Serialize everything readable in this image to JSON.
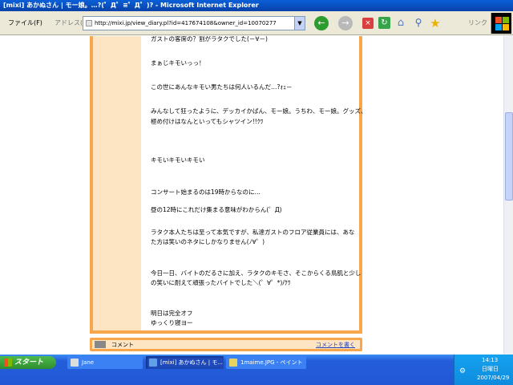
{
  "window": {
    "title": "[mixi] あかぬさん | モー娘。…?(゜Д゜≡゜Д゜)? - Microsoft Internet Explorer"
  },
  "toolbar": {
    "file_menu": "ファイル(F)",
    "address_label": "アドレス(D)",
    "address_url": "http://mixi.jp/view_diary.pl?id=417674108&owner_id=10070277",
    "links_label": "リンク"
  },
  "diary": {
    "lines": [
      "ガストの客席の？割がラタクでした(－∀－)",
      "まぁじキモいっっ！",
      "この世にあんなキモい男たちは何人いるんだ…?ｫｪ－",
      "みんなして狂ったように、デッカイかばん、モー娘。うちわ、モー娘。グッズ、",
      "極め付けはなんといってもシャツイン!!ｸﾜ",
      "キモいキモいキモい",
      "コンサート始まるのは19時からなのに…",
      "昼の12時にこれだけ集まる意味がわからん(゜Д)",
      "ラタク本人たちは至って本気ですが、私達ガストのフロア従業員には、あな",
      "た方は笑いのネタにしかなりません(ﾉ∀゜)",
      "今日一日、バイトのだるさに加え、ラタクのキモさ、そこからくる鳥肌と少し",
      "の笑いに耐えて頑張ったバイトでした＼(゜∀゜*)/ｸﾜ",
      "明日は完全オフ",
      "ゆっくり寝ヨー"
    ]
  },
  "comment": {
    "label": "コメント",
    "write_link": "コメントを書く"
  },
  "taskbar": {
    "start_label": "スタート",
    "items": [
      {
        "label": "Jane"
      },
      {
        "label": "[mixi] あかぬさん | モ..."
      },
      {
        "label": "1maime.JPG - ペイント"
      }
    ],
    "clock_time": "14:13",
    "clock_day": "日曜日",
    "clock_date": "2007/04/29"
  }
}
